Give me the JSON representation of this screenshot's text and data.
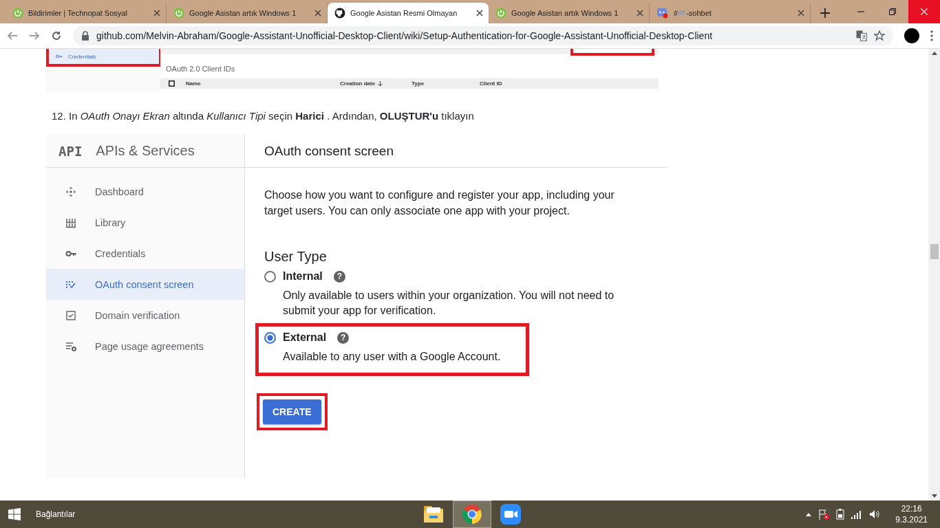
{
  "browser": {
    "tabs": [
      {
        "title": "Bildirimler | Technopat Sosyal",
        "kind": "power",
        "selected": false
      },
      {
        "title": "Google Asistan artık Windows 1",
        "kind": "power",
        "selected": false
      },
      {
        "title": "Google Asistan Resmi Olmayan",
        "kind": "github",
        "selected": true
      },
      {
        "title": "Google Asistan artık Windows 1",
        "kind": "power",
        "selected": false
      },
      {
        "title": "#",
        "title_rest": "-sohbet",
        "kind": "discord",
        "selected": false
      }
    ],
    "url": "github.com/Melvin-Abraham/Google-Assistant-Unofficial-Desktop-Client/wiki/Setup-Authentication-for-Google-Assistant-Unofficial-Desktop-Client"
  },
  "article": {
    "figure_top": {
      "sidebar_item": "Credentials",
      "section_title": "OAuth 2.0 Client IDs",
      "columns": [
        "Name",
        "Creation date",
        "Type",
        "Client ID"
      ]
    },
    "step_text": "12. In *OAuth Onayı Ekran* altında *Kullanıcı Tipi* seçin **Harici** . Ardından, **OLUŞTUR'u** tıklayın",
    "figure_main": {
      "logo": "API",
      "product": "APIs & Services",
      "page_title": "OAuth consent screen",
      "nav": [
        {
          "label": "Dashboard",
          "selected": false
        },
        {
          "label": "Library",
          "selected": false
        },
        {
          "label": "Credentials",
          "selected": false
        },
        {
          "label": "OAuth consent screen",
          "selected": true
        },
        {
          "label": "Domain verification",
          "selected": false
        },
        {
          "label": "Page usage agreements",
          "selected": false
        }
      ],
      "intro": "Choose how you want to configure and register your app, including your target users. You can only associate one app with your project.",
      "section": "User Type",
      "options": [
        {
          "label": "Internal",
          "help": "?",
          "description": "Only available to users within your organization. You will not need to submit your app for verification.",
          "selected": false
        },
        {
          "label": "External",
          "help": "?",
          "description": "Available to any user with a Google Account.",
          "selected": true
        }
      ],
      "create_button": "CREATE"
    }
  },
  "taskbar": {
    "start_label": "Bağlantılar",
    "apps": [
      {
        "kind": "explorer",
        "selected": false
      },
      {
        "kind": "chrome",
        "selected": true
      },
      {
        "kind": "zoom",
        "selected": false
      }
    ],
    "time": "22:16",
    "date": "9.3.2021"
  }
}
